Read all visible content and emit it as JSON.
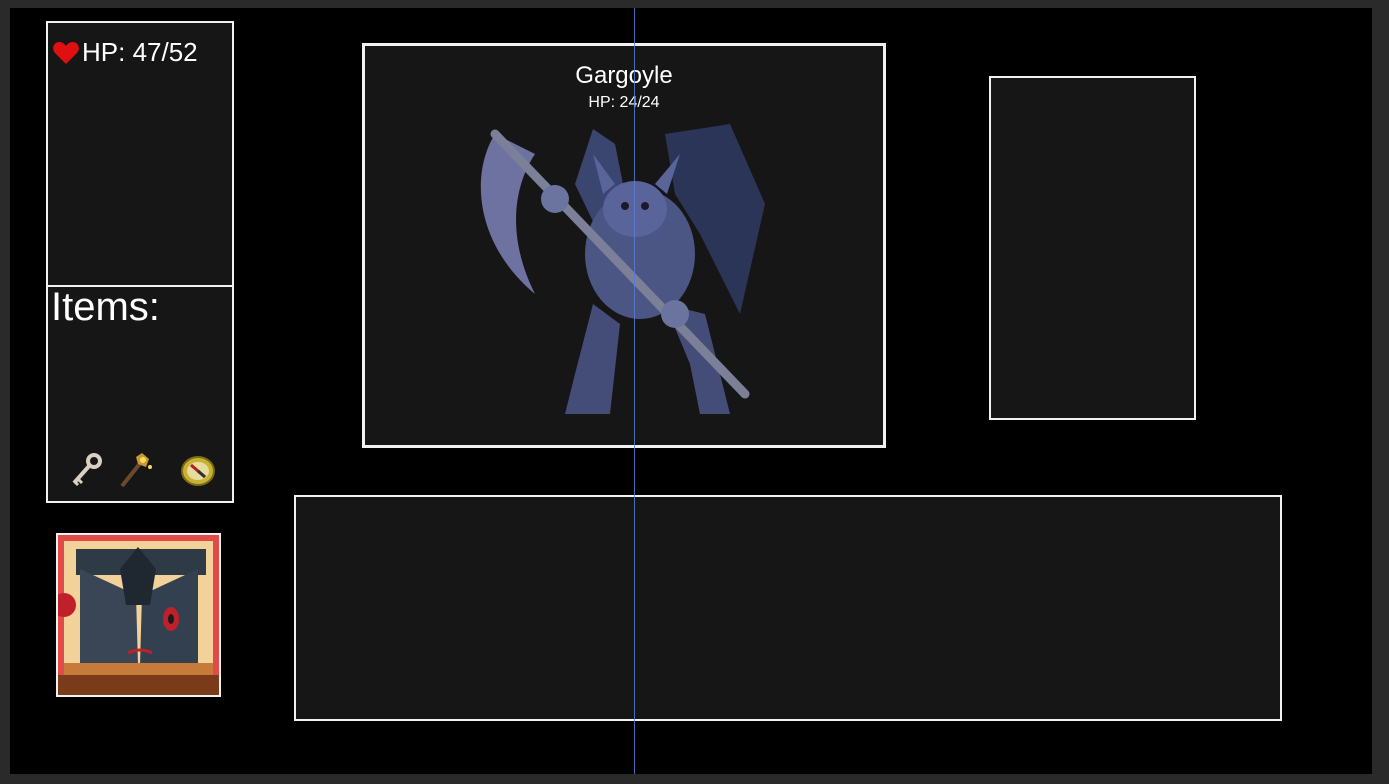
{
  "player": {
    "hp_text": "HP: 47/52",
    "hp_current": 47,
    "hp_max": 52,
    "heart_icon": "heart-icon",
    "heart_color": "#e01010"
  },
  "items": {
    "title": "Items:",
    "list": [
      {
        "icon": "key-icon"
      },
      {
        "icon": "staff-icon"
      },
      {
        "icon": "compass-icon"
      }
    ]
  },
  "portrait": {
    "icon": "player-portrait"
  },
  "enemy": {
    "name": "Gargoyle",
    "hp_text": "HP: 24/24",
    "hp_current": 24,
    "hp_max": 24,
    "icon": "gargoyle-sprite"
  },
  "colors": {
    "background": "#000000",
    "panel": "#161616",
    "panel_border": "#f2f2f2",
    "text": "#ffffff"
  }
}
